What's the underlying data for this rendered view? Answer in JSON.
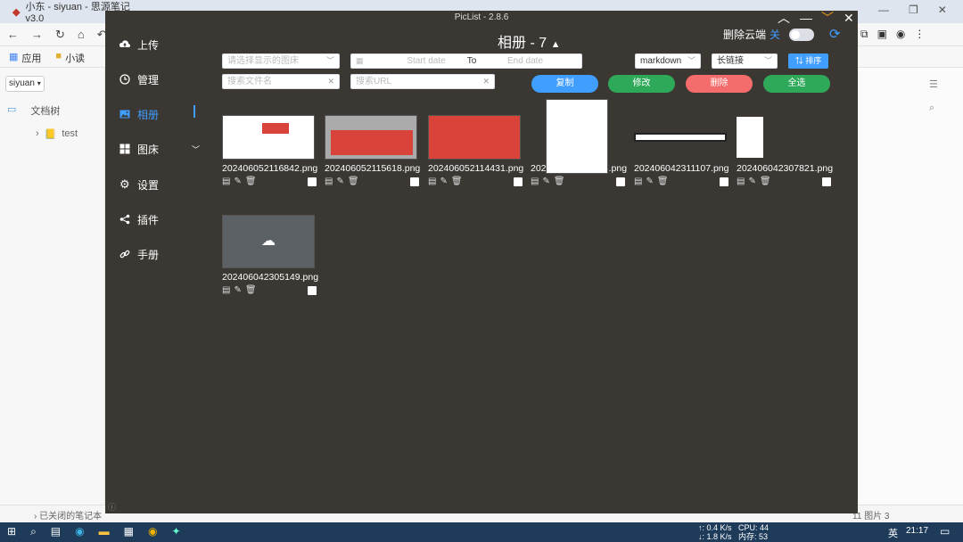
{
  "browser": {
    "tab_title": "小东 - siyuan - 思源笔记 v3.0",
    "bookmarks": [
      "应用",
      "小读"
    ],
    "workspace": "siyuan",
    "doc_tree_label": "文档树",
    "doc_item": "test",
    "closed_notebooks": "已关闭的笔记本",
    "status_right": "11  图片 3"
  },
  "taskbar": {
    "net_up": "↑: 0.4 K/s",
    "net_down": "↓: 1.8 K/s",
    "cpu": "CPU: 44",
    "mem": "内存: 53",
    "ime": "英",
    "time": "21:17"
  },
  "app": {
    "window_title": "PicList - 2.8.6",
    "menu": [
      {
        "label": "上传",
        "icon": "upload-icon"
      },
      {
        "label": "管理",
        "icon": "clock-icon"
      },
      {
        "label": "相册",
        "icon": "picture-icon"
      },
      {
        "label": "图床",
        "icon": "grid-icon"
      },
      {
        "label": "设置",
        "icon": "gear-icon"
      },
      {
        "label": "插件",
        "icon": "share-icon"
      },
      {
        "label": "手册",
        "icon": "link-icon"
      }
    ],
    "header": {
      "title": "相册 - 7",
      "delete_cloud_label": "删除云端",
      "delete_cloud_state": "关"
    },
    "filters": {
      "picbed_placeholder": "请选择显示的图床",
      "start_date": "Start date",
      "to": "To",
      "end_date": "End date",
      "format_value": "markdown",
      "link_value": "长链接",
      "sort_label": "排序",
      "filename_placeholder": "搜索文件名",
      "url_placeholder": "搜索URL"
    },
    "actions": {
      "copy": "复制",
      "edit": "修改",
      "delete": "删除",
      "select_all": "全选"
    },
    "images": [
      "202406052116842.png",
      "202406052115618.png",
      "202406052114431.png",
      "202406052056256.png",
      "202406042311107.png",
      "202406042307821.png",
      "202406042305149.png"
    ]
  }
}
